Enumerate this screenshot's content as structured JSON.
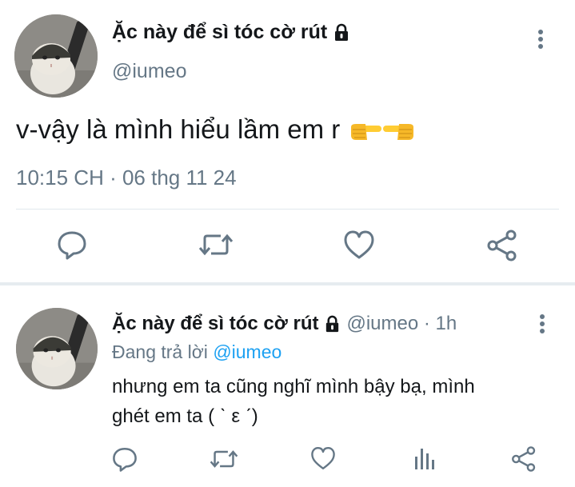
{
  "main_tweet": {
    "display_name": "Ặc này để sì tóc cờ rút",
    "handle": "@iumeo",
    "text": "v-vậy là mình hiểu lầm em r",
    "timestamp": "10:15 CH · 06 thg 11 24",
    "icons": {
      "lock": "lock-icon",
      "more": "more-vertical-icon",
      "emoji": [
        "pointing-right-emoji",
        "pointing-left-emoji"
      ],
      "actions": [
        "reply-icon",
        "retweet-icon",
        "like-icon",
        "share-icon"
      ]
    }
  },
  "reply": {
    "display_name": "Ặc này để sì tóc cờ rút",
    "handle_meta": "@iumeo · 1h",
    "replying_prefix": "Đang trả lời ",
    "replying_to": "@iumeo",
    "text": "nhưng em ta cũng nghĩ mình bậy bạ, mình\nghét em ta ( ˋ ε ˊ)",
    "icons": {
      "actions": [
        "reply-icon",
        "retweet-icon",
        "like-icon",
        "analytics-icon",
        "share-icon"
      ]
    }
  },
  "colors": {
    "text": "#14171a",
    "secondary": "#657786",
    "accent": "#1da1f2",
    "divider": "#e1e8ed",
    "section_divider": "#e6ecf0"
  }
}
